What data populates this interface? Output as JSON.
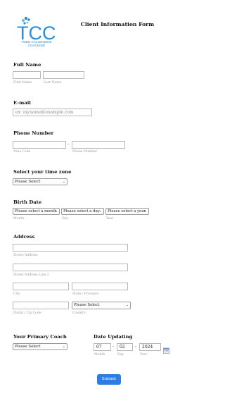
{
  "header": {
    "logo_text": "TCC",
    "logo_sub1": "TODD CALLENDINE",
    "logo_sub2": "COACHING",
    "title": "Client Information Form"
  },
  "full_name": {
    "label": "Full Name",
    "first_label": "First Name",
    "last_label": "Last Name",
    "first_value": "",
    "last_value": ""
  },
  "email": {
    "label": "E-mail",
    "placeholder": "ex: myname@example.com"
  },
  "phone": {
    "label": "Phone Number",
    "dash": "-",
    "area_label": "Area Code",
    "number_label": "Phone Number"
  },
  "timezone": {
    "label": "Select your time zone",
    "selected": "Please Select"
  },
  "birth_date": {
    "label": "Birth Date",
    "month_selected": "Please select a month",
    "day_selected": "Please select a day",
    "year_selected": "Please select a year",
    "month_label": "Month",
    "day_label": "Day",
    "year_label": "Year"
  },
  "address": {
    "label": "Address",
    "street_label": "Street Address",
    "street2_label": "Street Address Line 2",
    "city_label": "City",
    "state_label": "State / Province",
    "postal_label": "Postal / Zip Code",
    "country_label": "Country",
    "country_selected": "Please Select"
  },
  "primary_coach": {
    "label": "Your Primary Coach",
    "selected": "Please Select"
  },
  "date_updating": {
    "label": "Date Updating",
    "month": "07",
    "day": "02",
    "year": "2024",
    "dash": "-",
    "month_label": "Month",
    "day_label": "Day",
    "year_label": "Year"
  },
  "submit_label": "Submit",
  "colors": {
    "accent": "#2e7de3",
    "logo_blue": "#2a8fd6",
    "logo_teal": "#6fc2c8"
  }
}
